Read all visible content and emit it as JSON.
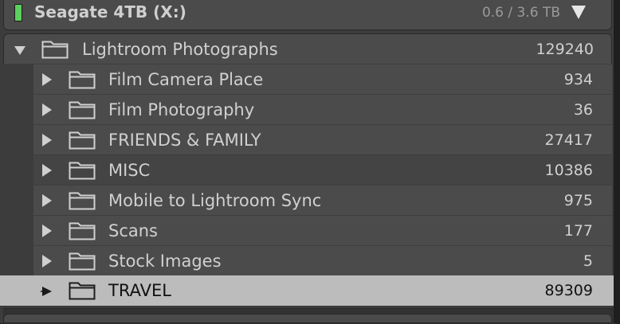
{
  "volume": {
    "name": "Seagate 4TB (X:)",
    "usage": "0.6 / 3.6 TB",
    "indicator_color": "#5cd05c",
    "toggle_icon": "triangle-down-icon"
  },
  "root_folder": {
    "name": "Lightroom Photographs",
    "count": "129240",
    "expanded": true
  },
  "folders": [
    {
      "name": "Film Camera Place",
      "count": "934"
    },
    {
      "name": "Film Photography",
      "count": "36"
    },
    {
      "name": "FRIENDS & FAMILY",
      "count": "27417"
    },
    {
      "name": "MISC",
      "count": "10386"
    },
    {
      "name": "Mobile to Lightroom Sync",
      "count": "975"
    },
    {
      "name": "Scans",
      "count": "177"
    },
    {
      "name": "Stock Images",
      "count": "5"
    },
    {
      "name": "TRAVEL",
      "count": "89309",
      "selected": true
    }
  ],
  "colors": {
    "panel": "#3c3c3c",
    "row": "#4b4b4b",
    "selected_row": "#bcbcbc",
    "text": "#d0d0d0"
  }
}
